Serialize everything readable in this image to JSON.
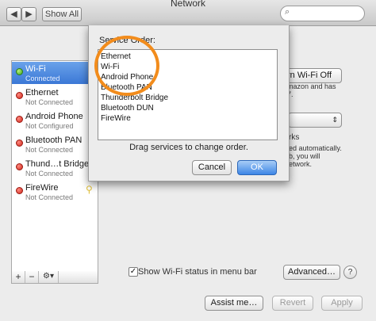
{
  "window": {
    "title": "Network",
    "nav": {
      "back": "◀",
      "forward": "▶",
      "show_all": "Show All"
    },
    "search": {
      "placeholder": ""
    }
  },
  "sidebar": {
    "items": [
      {
        "name": "Wi-Fi",
        "status": "Connected",
        "color": "#39a51c",
        "selected": true
      },
      {
        "name": "Ethernet",
        "status": "Not Connected",
        "color": "#d0261c"
      },
      {
        "name": "Android Phone",
        "status": "Not Configured",
        "color": "#d0261c"
      },
      {
        "name": "Bluetooth PAN",
        "status": "Not Connected",
        "color": "#d0261c"
      },
      {
        "name": "Thund…t Bridge",
        "status": "Not Connected",
        "color": "#d0261c"
      },
      {
        "name": "FireWire",
        "status": "Not Connected",
        "color": "#d0261c"
      }
    ],
    "footer": {
      "add": "+",
      "remove": "−",
      "gear": "⚙▾"
    }
  },
  "right_pane": {
    "turn_wifi_off": "rn Wi-Fi Off",
    "fragment_1": "mazon and has",
    "fragment_2": "7.",
    "fragment_3": "rks",
    "fragment_4": "ed automatically.",
    "fragment_5": "b, you will",
    "fragment_6": "etwork.",
    "show_wifi_status": "Show Wi-Fi status in menu bar",
    "show_wifi_checked": "✓",
    "advanced": "Advanced…",
    "help": "?",
    "assist": "Assist me…",
    "revert": "Revert",
    "apply": "Apply"
  },
  "sheet": {
    "heading": "Service Order:",
    "items": [
      "Ethernet",
      "Wi-Fi",
      "Android Phone",
      "Bluetooth PAN",
      "Thunderbolt Bridge",
      "Bluetooth DUN",
      "FireWire"
    ],
    "hint": "Drag services to change order.",
    "cancel": "Cancel",
    "ok": "OK",
    "highlight_color": "#f28c1c"
  }
}
